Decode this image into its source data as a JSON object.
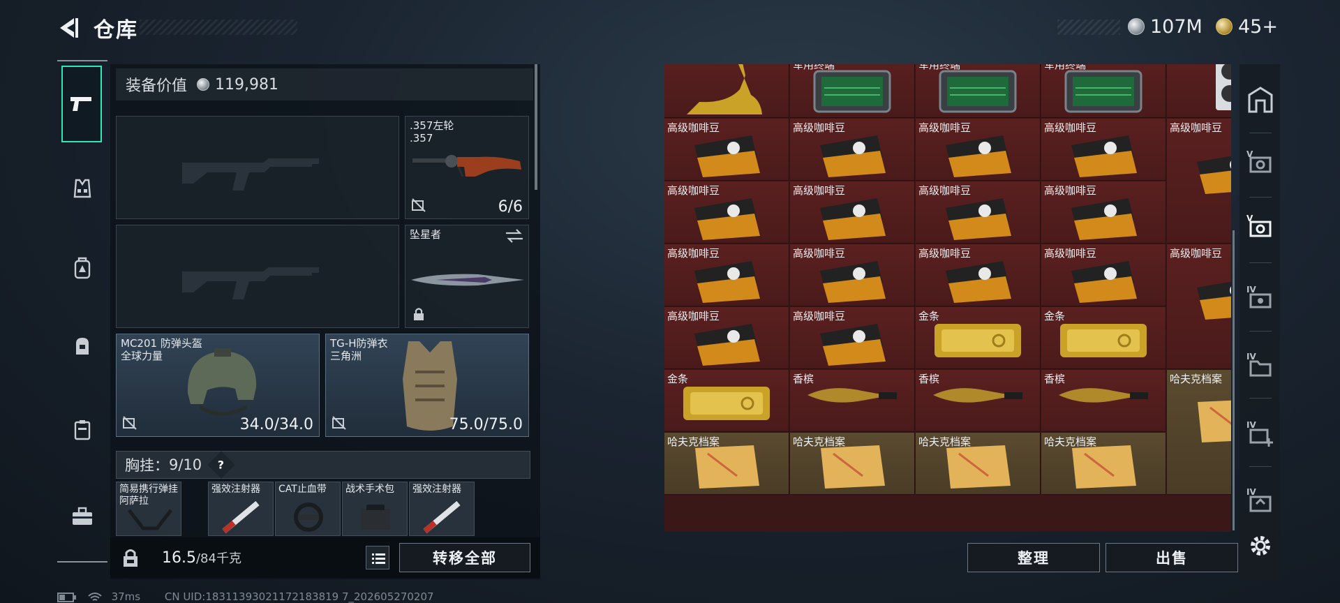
{
  "header": {
    "title": "仓库",
    "currencies": [
      {
        "icon": "silver-coin-icon",
        "amount": "107M"
      },
      {
        "icon": "gold-coin-icon",
        "amount": "45+"
      }
    ]
  },
  "left_tabs": [
    {
      "icon": "pistol-icon",
      "active": true
    },
    {
      "icon": "vest-icon",
      "active": false
    },
    {
      "icon": "backpack-icon",
      "active": false
    },
    {
      "icon": "pouch-icon",
      "active": false
    },
    {
      "icon": "case-icon",
      "active": false
    },
    {
      "icon": "toolbox-icon",
      "active": false
    }
  ],
  "equipment": {
    "value_label": "装备价值",
    "value": "119,981",
    "weapon_slots": [
      {
        "name": ".357左轮",
        "sub": ".357",
        "count": "6/6"
      },
      {
        "name": "坠星者",
        "sub": ""
      }
    ],
    "armor": [
      {
        "name": "MC201 防弹头盔",
        "sub": "全球力量",
        "durability": "34.0/34.0"
      },
      {
        "name": "TG-H防弹衣",
        "sub": "三角洲",
        "durability": "75.0/75.0"
      }
    ],
    "vest": {
      "label": "胸挂：",
      "capacity": "9/10",
      "help": "?"
    },
    "vest_items": [
      {
        "name": "简易携行弹挂",
        "sub": "阿萨拉"
      },
      {
        "name": "强效注射器",
        "sub": ""
      },
      {
        "name": "CAT止血带",
        "sub": ""
      },
      {
        "name": "战术手术包",
        "sub": ""
      },
      {
        "name": "强效注射器",
        "sub": ""
      }
    ],
    "weight": {
      "current": "16.5",
      "max": "/84千克"
    },
    "transfer_all": "转移全部"
  },
  "storage": {
    "rows": [
      [
        "",
        "军用终端",
        "军用终端",
        "军用终端",
        ""
      ],
      [
        "高级咖啡豆",
        "高级咖啡豆",
        "高级咖啡豆",
        "高级咖啡豆",
        "高级咖啡豆"
      ],
      [
        "高级咖啡豆",
        "高级咖啡豆",
        "高级咖啡豆",
        "高级咖啡豆",
        ""
      ],
      [
        "高级咖啡豆",
        "高级咖啡豆",
        "高级咖啡豆",
        "高级咖啡豆",
        "高级咖啡豆"
      ],
      [
        "高级咖啡豆",
        "高级咖啡豆",
        "金条",
        "金条",
        ""
      ],
      [
        "金条",
        "香槟",
        "香槟",
        "香槟",
        "哈夫克档案"
      ],
      [
        "哈夫克档案",
        "哈夫克档案",
        "哈夫克档案",
        "哈夫克档案",
        ""
      ]
    ],
    "organize": "整理",
    "sell": "出售"
  },
  "right_tabs": [
    {
      "icon": "storage-home-icon",
      "label": ""
    },
    {
      "icon": "storage-v-icon",
      "label": "V"
    },
    {
      "icon": "storage-v-active-icon",
      "label": "V"
    },
    {
      "icon": "storage-iv-icon",
      "label": "IV"
    },
    {
      "icon": "storage-iv-folder-icon",
      "label": "IV"
    },
    {
      "icon": "storage-iv-add-icon",
      "label": "IV"
    },
    {
      "icon": "storage-iv-box-icon",
      "label": "IV"
    },
    {
      "icon": "settings-gear-icon",
      "label": ""
    }
  ],
  "status_bar": {
    "ping": "37ms",
    "uid": "CN UID:18311393021172183819 7_202605270207"
  },
  "colors": {
    "accent": "#2ee8b5",
    "storage_cell": "#4a1a1a",
    "storage_cell_amber": "#4a3c26"
  }
}
